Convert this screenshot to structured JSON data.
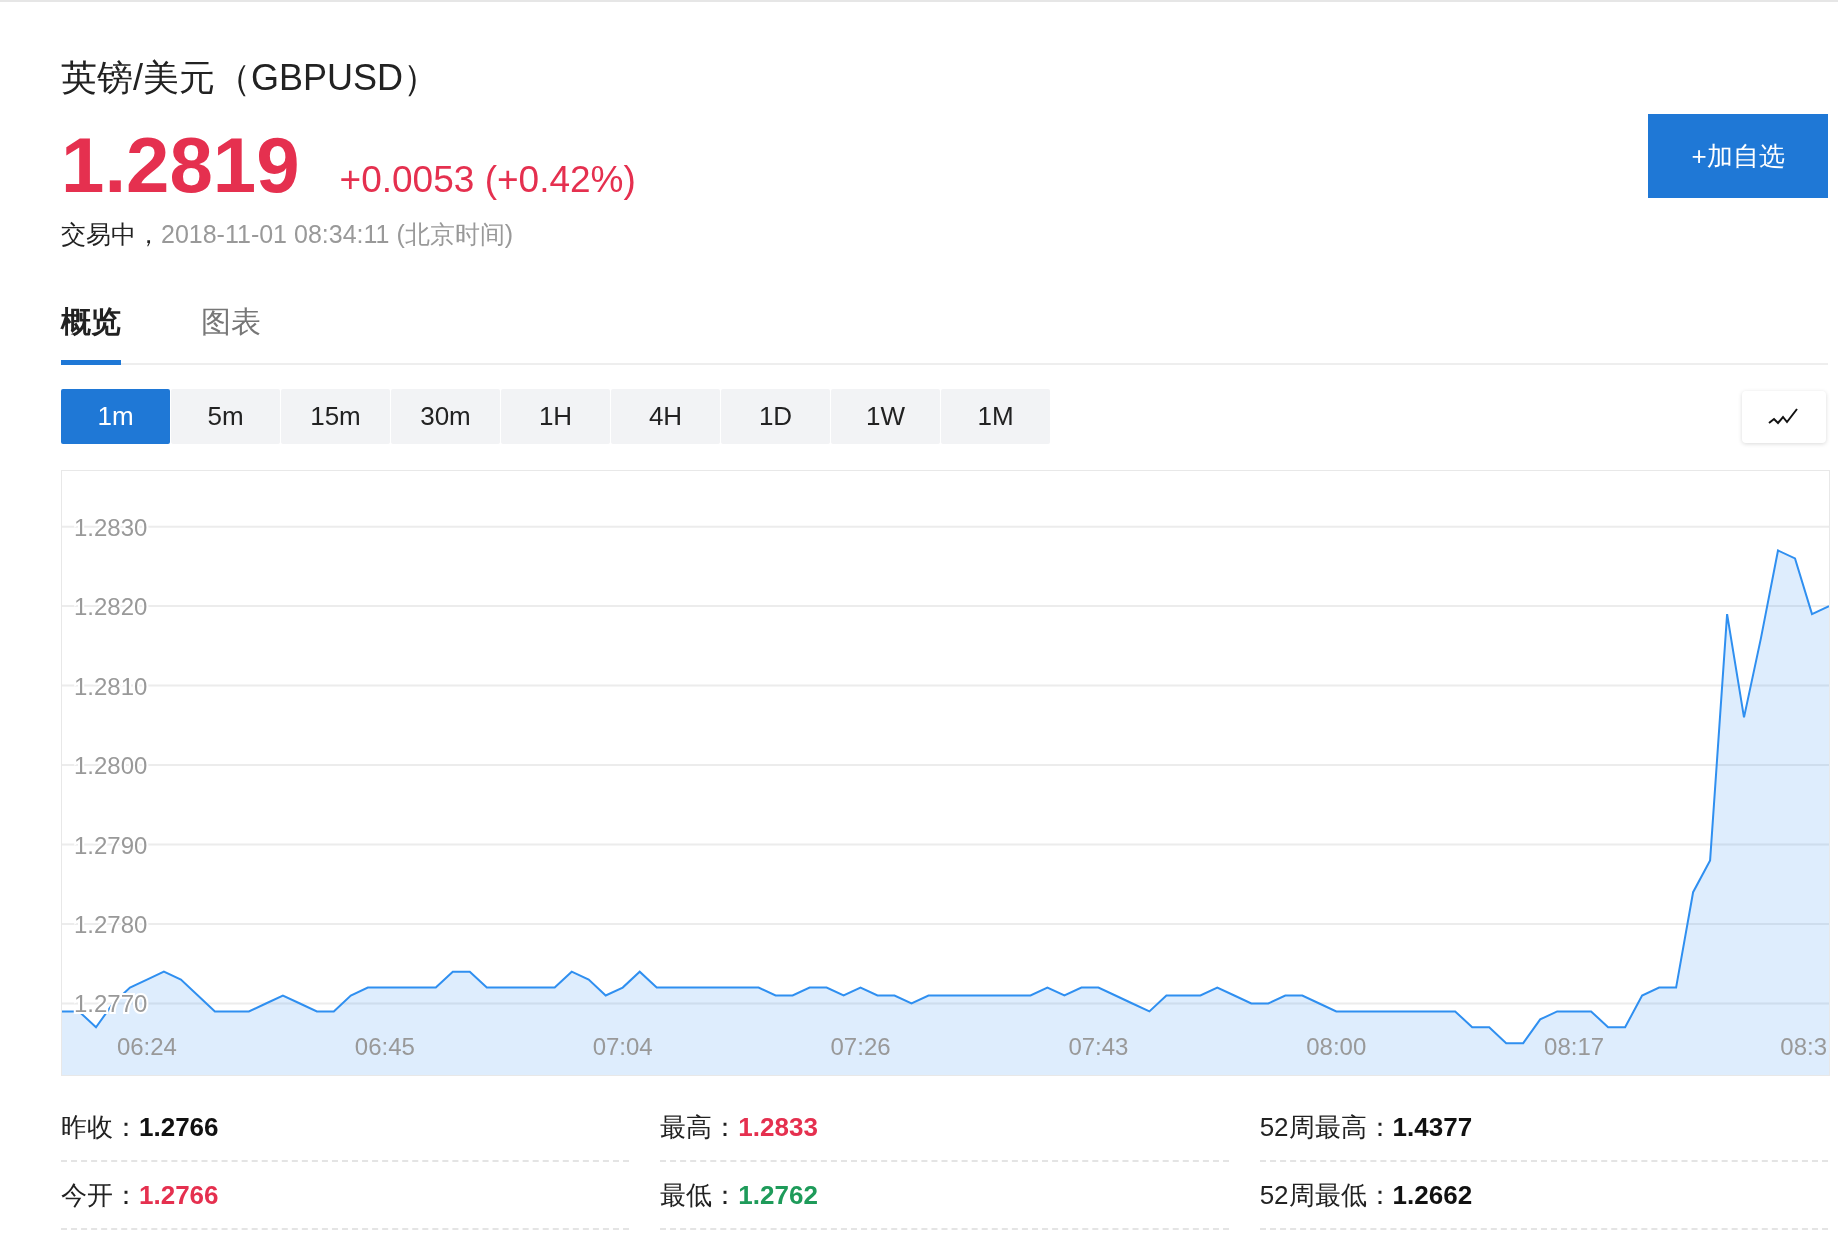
{
  "quote": {
    "title": "英镑/美元（GBPUSD）",
    "price": "1.2819",
    "change": "+0.0053 (+0.42%)",
    "status_label": "交易中，",
    "timestamp": "2018-11-01 08:34:11 (北京时间)"
  },
  "watchlist_button": "+加自选",
  "tabs": [
    {
      "label": "概览",
      "selected": true
    },
    {
      "label": "图表",
      "selected": false
    }
  ],
  "intervals": [
    {
      "label": "1m",
      "selected": true
    },
    {
      "label": "5m",
      "selected": false
    },
    {
      "label": "15m",
      "selected": false
    },
    {
      "label": "30m",
      "selected": false
    },
    {
      "label": "1H",
      "selected": false
    },
    {
      "label": "4H",
      "selected": false
    },
    {
      "label": "1D",
      "selected": false
    },
    {
      "label": "1W",
      "selected": false
    },
    {
      "label": "1M",
      "selected": false
    }
  ],
  "chart": {
    "chart_data": {
      "type": "area",
      "ylim": [
        1.2761,
        1.2837
      ],
      "grid": true,
      "categories": [
        null,
        null,
        null,
        null,
        null,
        "06:24",
        null,
        null,
        null,
        null,
        null,
        null,
        null,
        null,
        null,
        null,
        null,
        null,
        null,
        "06:45",
        null,
        null,
        null,
        null,
        null,
        null,
        null,
        null,
        null,
        null,
        null,
        null,
        null,
        "07:04",
        null,
        null,
        null,
        null,
        null,
        null,
        null,
        null,
        null,
        null,
        null,
        null,
        null,
        "07:26",
        null,
        null,
        null,
        null,
        null,
        null,
        null,
        null,
        null,
        null,
        null,
        null,
        null,
        "07:43",
        null,
        null,
        null,
        null,
        null,
        null,
        null,
        null,
        null,
        null,
        null,
        null,
        null,
        "08:00",
        null,
        null,
        null,
        null,
        null,
        null,
        null,
        null,
        null,
        null,
        null,
        null,
        null,
        "08:17",
        null,
        null,
        null,
        null,
        null,
        null,
        null,
        null,
        null,
        null,
        null,
        null,
        null,
        "08:3",
        null
      ],
      "yticks": [
        {
          "value": 1.283,
          "label": "1.2830"
        },
        {
          "value": 1.282,
          "label": "1.2820"
        },
        {
          "value": 1.281,
          "label": "1.2810"
        },
        {
          "value": 1.28,
          "label": "1.2800"
        },
        {
          "value": 1.279,
          "label": "1.2790"
        },
        {
          "value": 1.278,
          "label": "1.2780"
        },
        {
          "value": 1.277,
          "label": "1.2770"
        }
      ],
      "series": [
        {
          "color": "#2f8ff0",
          "values": [
            1.2769,
            1.2769,
            1.2767,
            1.277,
            1.2772,
            1.2773,
            1.2774,
            1.2773,
            1.2771,
            1.2769,
            1.2769,
            1.2769,
            1.277,
            1.2771,
            1.277,
            1.2769,
            1.2769,
            1.2771,
            1.2772,
            1.2772,
            1.2772,
            1.2772,
            1.2772,
            1.2774,
            1.2774,
            1.2772,
            1.2772,
            1.2772,
            1.2772,
            1.2772,
            1.2774,
            1.2773,
            1.2771,
            1.2772,
            1.2774,
            1.2772,
            1.2772,
            1.2772,
            1.2772,
            1.2772,
            1.2772,
            1.2772,
            1.2771,
            1.2771,
            1.2772,
            1.2772,
            1.2771,
            1.2772,
            1.2771,
            1.2771,
            1.277,
            1.2771,
            1.2771,
            1.2771,
            1.2771,
            1.2771,
            1.2771,
            1.2771,
            1.2772,
            1.2771,
            1.2772,
            1.2772,
            1.2771,
            1.277,
            1.2769,
            1.2771,
            1.2771,
            1.2771,
            1.2772,
            1.2771,
            1.277,
            1.277,
            1.2771,
            1.2771,
            1.277,
            1.2769,
            1.2769,
            1.2769,
            1.2769,
            1.2769,
            1.2769,
            1.2769,
            1.2769,
            1.2767,
            1.2767,
            1.2765,
            1.2765,
            1.2768,
            1.2769,
            1.2769,
            1.2769,
            1.2767,
            1.2767,
            1.2771,
            1.2772,
            1.2772,
            1.2784,
            1.2788,
            1.2819,
            1.2806,
            1.2816,
            1.2827,
            1.2826,
            1.2819,
            1.282
          ]
        }
      ]
    }
  },
  "stats": [
    {
      "label": "昨收：",
      "value": "1.2766",
      "color": "#111111"
    },
    {
      "label": "最高：",
      "value": "1.2833",
      "color": "#e5304f"
    },
    {
      "label": "52周最高：",
      "value": "1.4377",
      "color": "#111111"
    },
    {
      "label": "今开：",
      "value": "1.2766",
      "color": "#e5304f"
    },
    {
      "label": "最低：",
      "value": "1.2762",
      "color": "#1e9b5a"
    },
    {
      "label": "52周最低：",
      "value": "1.2662",
      "color": "#111111"
    }
  ]
}
